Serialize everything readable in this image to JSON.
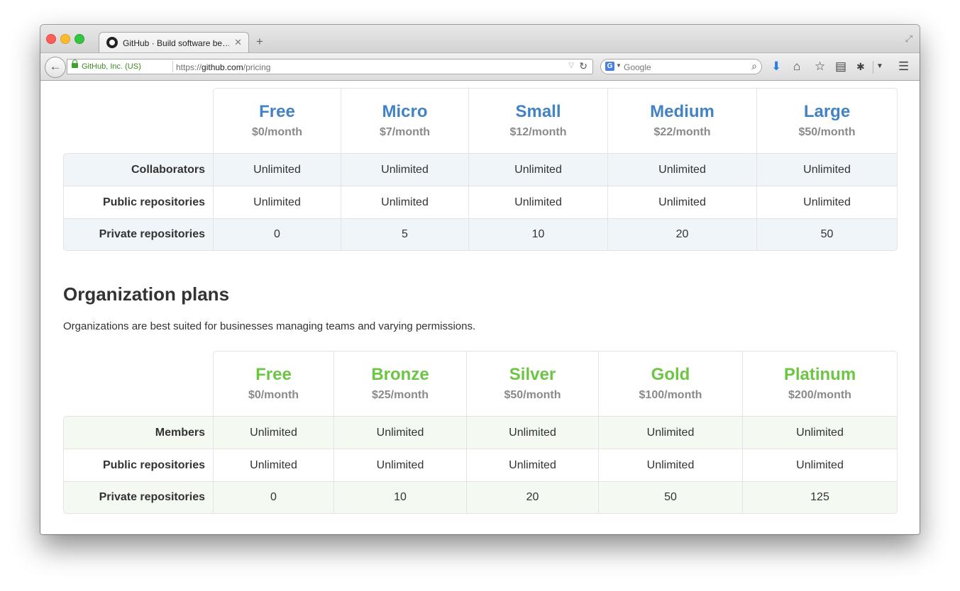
{
  "browser": {
    "tab_title": "GitHub · Build software be…",
    "identity_label": "GitHub, Inc. (US)",
    "url_prefix": "https://",
    "url_domain": "github.com",
    "url_path": "/pricing",
    "search_placeholder": "Google",
    "search_engine_icon": "G"
  },
  "personal_plans": {
    "plans": [
      {
        "name": "Free",
        "price": "$0/month"
      },
      {
        "name": "Micro",
        "price": "$7/month"
      },
      {
        "name": "Small",
        "price": "$12/month"
      },
      {
        "name": "Medium",
        "price": "$22/month"
      },
      {
        "name": "Large",
        "price": "$50/month"
      }
    ],
    "rows": [
      {
        "label": "Collaborators",
        "values": [
          "Unlimited",
          "Unlimited",
          "Unlimited",
          "Unlimited",
          "Unlimited"
        ]
      },
      {
        "label": "Public repositories",
        "values": [
          "Unlimited",
          "Unlimited",
          "Unlimited",
          "Unlimited",
          "Unlimited"
        ]
      },
      {
        "label": "Private repositories",
        "values": [
          "0",
          "5",
          "10",
          "20",
          "50"
        ]
      }
    ]
  },
  "organization": {
    "title": "Organization plans",
    "description": "Organizations are best suited for businesses managing teams and varying permissions.",
    "plans": [
      {
        "name": "Free",
        "price": "$0/month"
      },
      {
        "name": "Bronze",
        "price": "$25/month"
      },
      {
        "name": "Silver",
        "price": "$50/month"
      },
      {
        "name": "Gold",
        "price": "$100/month"
      },
      {
        "name": "Platinum",
        "price": "$200/month"
      }
    ],
    "rows": [
      {
        "label": "Members",
        "values": [
          "Unlimited",
          "Unlimited",
          "Unlimited",
          "Unlimited",
          "Unlimited"
        ]
      },
      {
        "label": "Public repositories",
        "values": [
          "Unlimited",
          "Unlimited",
          "Unlimited",
          "Unlimited",
          "Unlimited"
        ]
      },
      {
        "label": "Private repositories",
        "values": [
          "0",
          "10",
          "20",
          "50",
          "125"
        ]
      }
    ]
  },
  "colors": {
    "personal_accent": "#4183c4",
    "organization_accent": "#6cc644"
  }
}
